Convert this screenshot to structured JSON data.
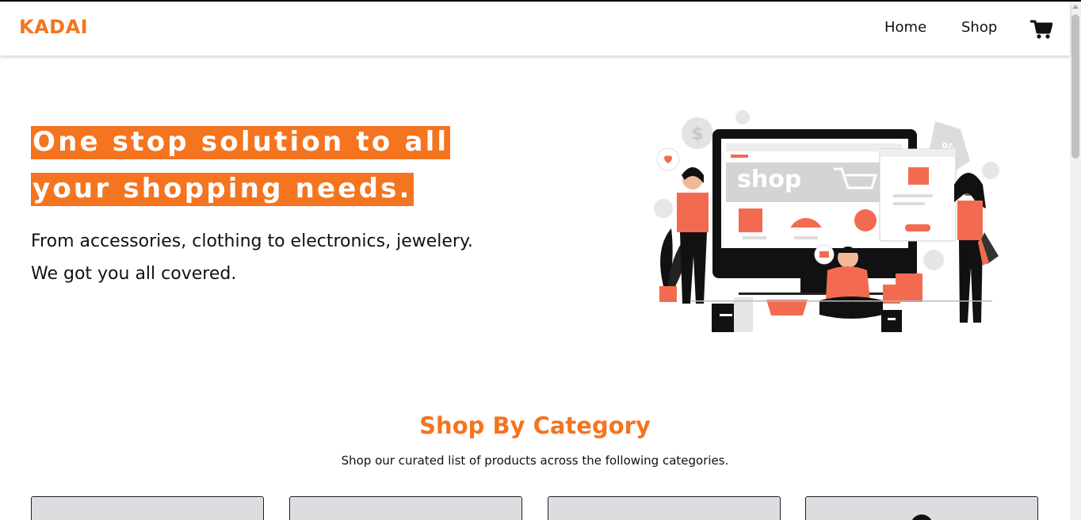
{
  "brand": {
    "name": "KADAI",
    "accent_color": "#f47420"
  },
  "nav": {
    "items": [
      {
        "label": "Home"
      },
      {
        "label": "Shop"
      }
    ],
    "cart_icon": "shopping-cart-icon"
  },
  "hero": {
    "title": "One stop solution to all your shopping needs.",
    "subtitle_line1": "From accessories, clothing to electronics, jewelery.",
    "subtitle_line2": "We got you all covered.",
    "illustration_text": "shop"
  },
  "categories": {
    "title": "Shop By Category",
    "subtitle": "Shop our curated list of products across the following categories.",
    "cards": [
      {},
      {},
      {},
      {}
    ]
  }
}
